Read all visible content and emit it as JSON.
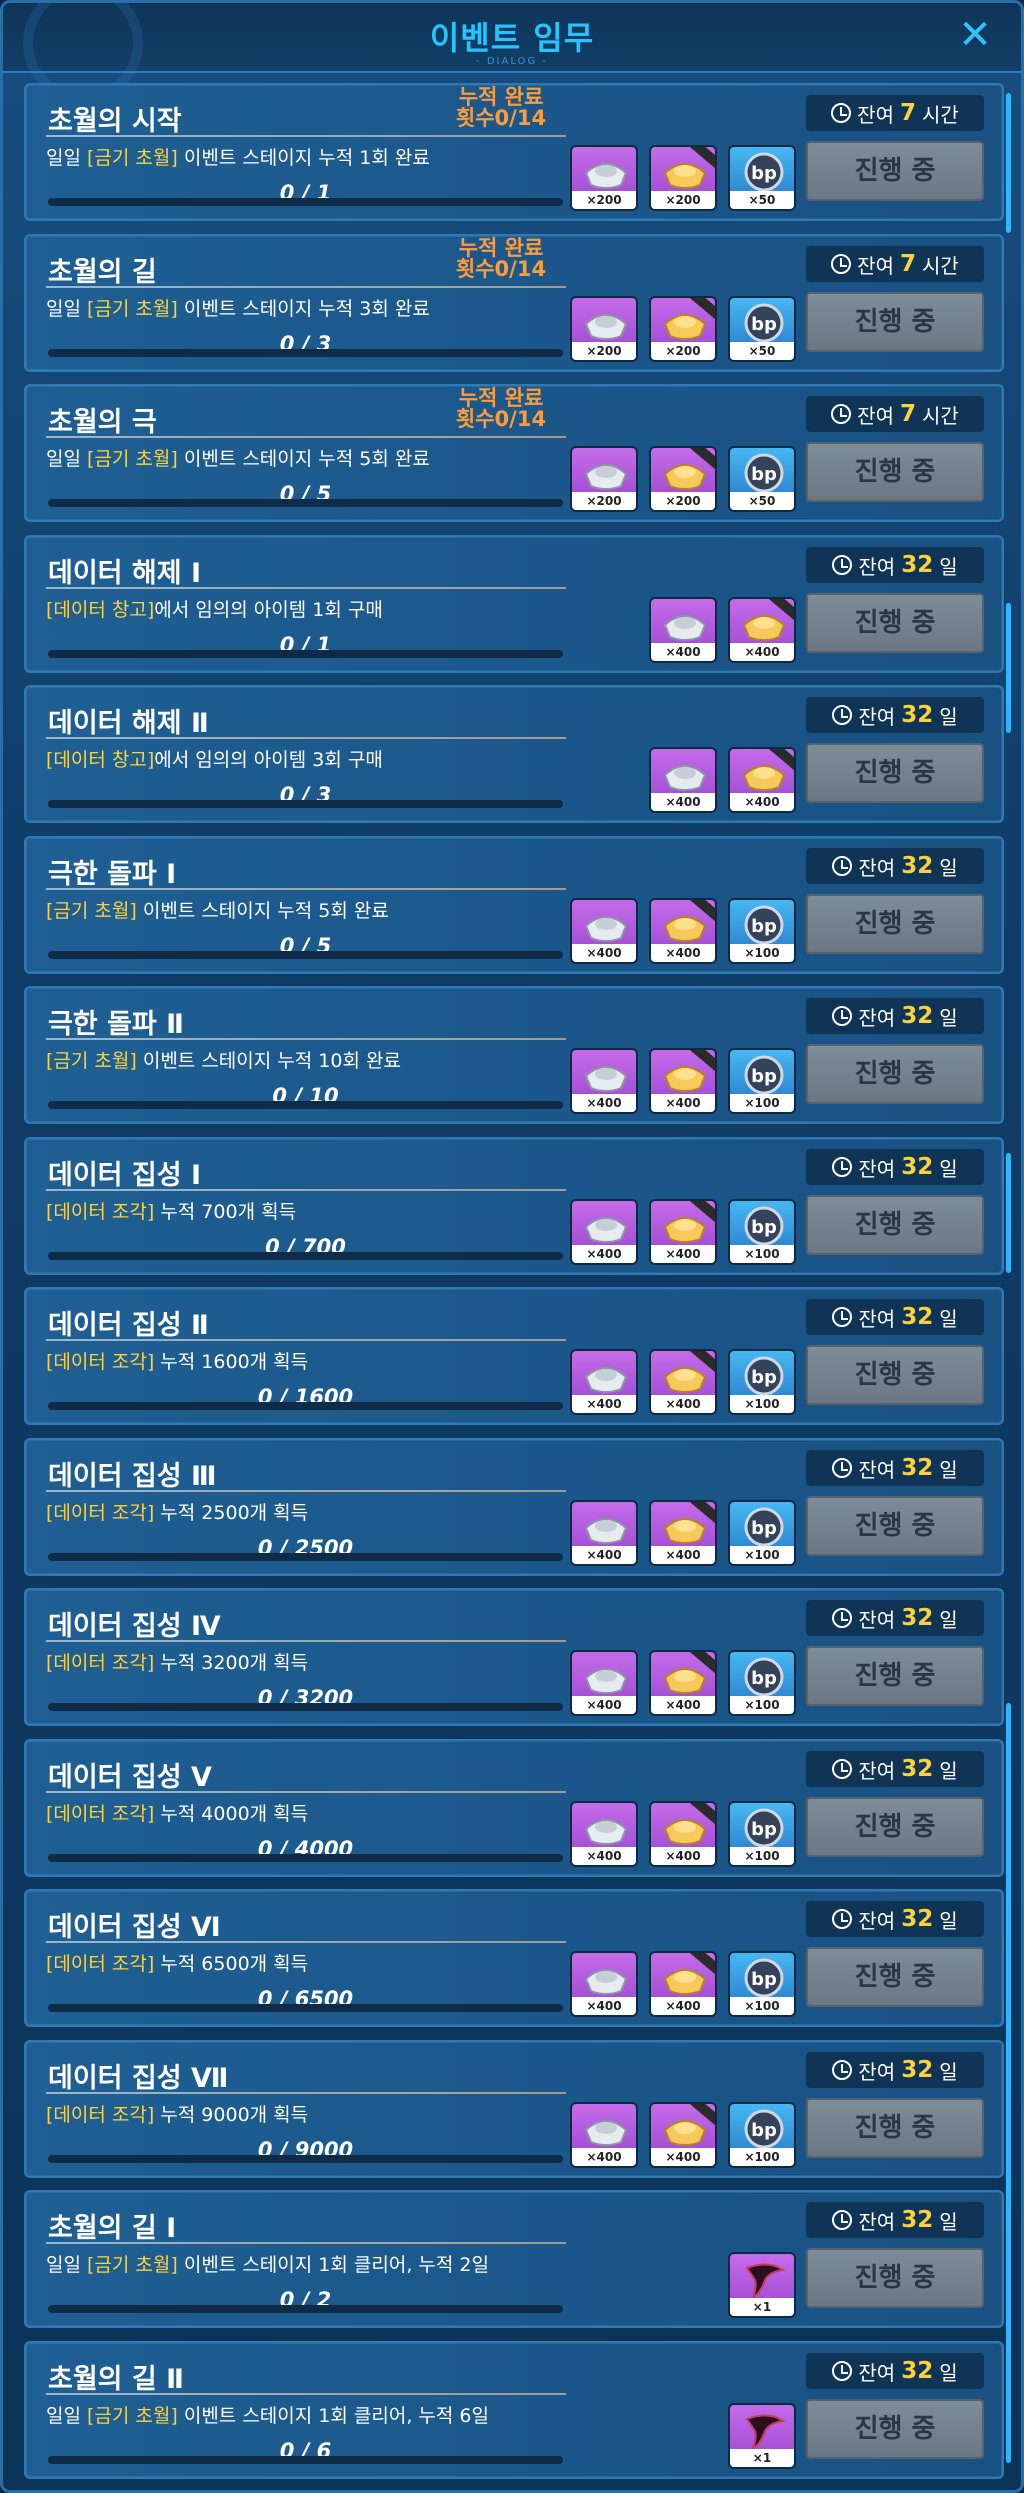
{
  "dialog": {
    "title": "이벤트 임무",
    "subtitle": "- DIALOG -"
  },
  "colors": {
    "accent": "#27c3ff",
    "highlight": "#ffd23c",
    "cumulative": "#ff9c3a",
    "status_bg": "#74828e"
  },
  "tasks": [
    {
      "title": "초월의 시작",
      "cum": "누적 완료\n횟수0/14",
      "desc_pre": "일일 ",
      "desc_hl": "[금기 초월]",
      "desc_post": " 이벤트 스테이지 누적 1회 완료",
      "progress": "0 / 1",
      "progress_value": 0,
      "time_label": "잔여",
      "time_num": "7",
      "time_unit": "시간",
      "status": "진행 중",
      "rewards": [
        {
          "kind": "purple",
          "icon": "silver-ingot-icon",
          "qty": "×200"
        },
        {
          "kind": "purple",
          "icon": "gold-ingot-icon",
          "qty": "×200"
        },
        {
          "kind": "blue",
          "icon": "bp-coin-icon",
          "qty": "×50"
        }
      ]
    },
    {
      "title": "초월의 길",
      "cum": "누적 완료\n횟수0/14",
      "desc_pre": "일일 ",
      "desc_hl": "[금기 초월]",
      "desc_post": " 이벤트 스테이지 누적 3회 완료",
      "progress": "0 / 3",
      "progress_value": 0,
      "time_label": "잔여",
      "time_num": "7",
      "time_unit": "시간",
      "status": "진행 중",
      "rewards": [
        {
          "kind": "purple",
          "icon": "silver-ingot-icon",
          "qty": "×200"
        },
        {
          "kind": "purple",
          "icon": "gold-ingot-icon",
          "qty": "×200"
        },
        {
          "kind": "blue",
          "icon": "bp-coin-icon",
          "qty": "×50"
        }
      ]
    },
    {
      "title": "초월의 극",
      "cum": "누적 완료\n횟수0/14",
      "desc_pre": "일일 ",
      "desc_hl": "[금기 초월]",
      "desc_post": " 이벤트 스테이지 누적 5회 완료",
      "progress": "0 / 5",
      "progress_value": 0,
      "time_label": "잔여",
      "time_num": "7",
      "time_unit": "시간",
      "status": "진행 중",
      "rewards": [
        {
          "kind": "purple",
          "icon": "silver-ingot-icon",
          "qty": "×200"
        },
        {
          "kind": "purple",
          "icon": "gold-ingot-icon",
          "qty": "×200"
        },
        {
          "kind": "blue",
          "icon": "bp-coin-icon",
          "qty": "×50"
        }
      ]
    },
    {
      "title": "데이터 해제 Ⅰ",
      "cum": "",
      "desc_pre": "",
      "desc_hl": "[데이터 창고]",
      "desc_post": "에서 임의의 아이템 1회 구매",
      "progress": "0 / 1",
      "progress_value": 0,
      "time_label": "잔여",
      "time_num": "32",
      "time_unit": "일",
      "status": "진행 중",
      "rewards": [
        {
          "kind": "purple",
          "icon": "silver-ingot-icon",
          "qty": "×400"
        },
        {
          "kind": "purple",
          "icon": "gold-ingot-icon",
          "qty": "×400"
        }
      ]
    },
    {
      "title": "데이터 해제 Ⅱ",
      "cum": "",
      "desc_pre": "",
      "desc_hl": "[데이터 창고]",
      "desc_post": "에서 임의의 아이템 3회 구매",
      "progress": "0 / 3",
      "progress_value": 0,
      "time_label": "잔여",
      "time_num": "32",
      "time_unit": "일",
      "status": "진행 중",
      "rewards": [
        {
          "kind": "purple",
          "icon": "silver-ingot-icon",
          "qty": "×400"
        },
        {
          "kind": "purple",
          "icon": "gold-ingot-icon",
          "qty": "×400"
        }
      ]
    },
    {
      "title": "극한 돌파 Ⅰ",
      "cum": "",
      "desc_pre": "",
      "desc_hl": "[금기 초월]",
      "desc_post": " 이벤트 스테이지 누적 5회 완료",
      "progress": "0 / 5",
      "progress_value": 0,
      "time_label": "잔여",
      "time_num": "32",
      "time_unit": "일",
      "status": "진행 중",
      "rewards": [
        {
          "kind": "purple",
          "icon": "silver-ingot-icon",
          "qty": "×400"
        },
        {
          "kind": "purple",
          "icon": "gold-ingot-icon",
          "qty": "×400"
        },
        {
          "kind": "blue",
          "icon": "bp-coin-icon",
          "qty": "×100"
        }
      ]
    },
    {
      "title": "극한 돌파 Ⅱ",
      "cum": "",
      "desc_pre": "",
      "desc_hl": "[금기 초월]",
      "desc_post": " 이벤트 스테이지 누적 10회 완료",
      "progress": "0 / 10",
      "progress_value": 0,
      "time_label": "잔여",
      "time_num": "32",
      "time_unit": "일",
      "status": "진행 중",
      "rewards": [
        {
          "kind": "purple",
          "icon": "silver-ingot-icon",
          "qty": "×400"
        },
        {
          "kind": "purple",
          "icon": "gold-ingot-icon",
          "qty": "×400"
        },
        {
          "kind": "blue",
          "icon": "bp-coin-icon",
          "qty": "×100"
        }
      ]
    },
    {
      "title": "데이터 집성 Ⅰ",
      "cum": "",
      "desc_pre": "",
      "desc_hl": "[데이터 조각]",
      "desc_post": " 누적 700개 획득",
      "progress": "0 / 700",
      "progress_value": 0,
      "time_label": "잔여",
      "time_num": "32",
      "time_unit": "일",
      "status": "진행 중",
      "rewards": [
        {
          "kind": "purple",
          "icon": "silver-ingot-icon",
          "qty": "×400"
        },
        {
          "kind": "purple",
          "icon": "gold-ingot-icon",
          "qty": "×400"
        },
        {
          "kind": "blue",
          "icon": "bp-coin-icon",
          "qty": "×100"
        }
      ]
    },
    {
      "title": "데이터 집성 Ⅱ",
      "cum": "",
      "desc_pre": "",
      "desc_hl": "[데이터 조각]",
      "desc_post": " 누적 1600개 획득",
      "progress": "0 / 1600",
      "progress_value": 0,
      "time_label": "잔여",
      "time_num": "32",
      "time_unit": "일",
      "status": "진행 중",
      "rewards": [
        {
          "kind": "purple",
          "icon": "silver-ingot-icon",
          "qty": "×400"
        },
        {
          "kind": "purple",
          "icon": "gold-ingot-icon",
          "qty": "×400"
        },
        {
          "kind": "blue",
          "icon": "bp-coin-icon",
          "qty": "×100"
        }
      ]
    },
    {
      "title": "데이터 집성 Ⅲ",
      "cum": "",
      "desc_pre": "",
      "desc_hl": "[데이터 조각]",
      "desc_post": " 누적 2500개 획득",
      "progress": "0 / 2500",
      "progress_value": 0,
      "time_label": "잔여",
      "time_num": "32",
      "time_unit": "일",
      "status": "진행 중",
      "rewards": [
        {
          "kind": "purple",
          "icon": "silver-ingot-icon",
          "qty": "×400"
        },
        {
          "kind": "purple",
          "icon": "gold-ingot-icon",
          "qty": "×400"
        },
        {
          "kind": "blue",
          "icon": "bp-coin-icon",
          "qty": "×100"
        }
      ]
    },
    {
      "title": "데이터 집성 Ⅳ",
      "cum": "",
      "desc_pre": "",
      "desc_hl": "[데이터 조각]",
      "desc_post": " 누적 3200개 획득",
      "progress": "0 / 3200",
      "progress_value": 0,
      "time_label": "잔여",
      "time_num": "32",
      "time_unit": "일",
      "status": "진행 중",
      "rewards": [
        {
          "kind": "purple",
          "icon": "silver-ingot-icon",
          "qty": "×400"
        },
        {
          "kind": "purple",
          "icon": "gold-ingot-icon",
          "qty": "×400"
        },
        {
          "kind": "blue",
          "icon": "bp-coin-icon",
          "qty": "×100"
        }
      ]
    },
    {
      "title": "데이터 집성 Ⅴ",
      "cum": "",
      "desc_pre": "",
      "desc_hl": "[데이터 조각]",
      "desc_post": " 누적 4000개 획득",
      "progress": "0 / 4000",
      "progress_value": 0,
      "time_label": "잔여",
      "time_num": "32",
      "time_unit": "일",
      "status": "진행 중",
      "rewards": [
        {
          "kind": "purple",
          "icon": "silver-ingot-icon",
          "qty": "×400"
        },
        {
          "kind": "purple",
          "icon": "gold-ingot-icon",
          "qty": "×400"
        },
        {
          "kind": "blue",
          "icon": "bp-coin-icon",
          "qty": "×100"
        }
      ]
    },
    {
      "title": "데이터 집성 Ⅵ",
      "cum": "",
      "desc_pre": "",
      "desc_hl": "[데이터 조각]",
      "desc_post": " 누적 6500개 획득",
      "progress": "0 / 6500",
      "progress_value": 0,
      "time_label": "잔여",
      "time_num": "32",
      "time_unit": "일",
      "status": "진행 중",
      "rewards": [
        {
          "kind": "purple",
          "icon": "silver-ingot-icon",
          "qty": "×400"
        },
        {
          "kind": "purple",
          "icon": "gold-ingot-icon",
          "qty": "×400"
        },
        {
          "kind": "blue",
          "icon": "bp-coin-icon",
          "qty": "×100"
        }
      ]
    },
    {
      "title": "데이터 집성 Ⅶ",
      "cum": "",
      "desc_pre": "",
      "desc_hl": "[데이터 조각]",
      "desc_post": " 누적 9000개 획득",
      "progress": "0 / 9000",
      "progress_value": 0,
      "time_label": "잔여",
      "time_num": "32",
      "time_unit": "일",
      "status": "진행 중",
      "rewards": [
        {
          "kind": "purple",
          "icon": "silver-ingot-icon",
          "qty": "×400"
        },
        {
          "kind": "purple",
          "icon": "gold-ingot-icon",
          "qty": "×400"
        },
        {
          "kind": "blue",
          "icon": "bp-coin-icon",
          "qty": "×100"
        }
      ]
    },
    {
      "title": "초월의 길 Ⅰ",
      "cum": "",
      "desc_pre": "일일 ",
      "desc_hl": "[금기 초월]",
      "desc_post": " 이벤트 스테이지 1회 클리어, 누적 2일",
      "progress": "0 / 2",
      "progress_value": 0,
      "time_label": "잔여",
      "time_num": "32",
      "time_unit": "일",
      "status": "진행 중",
      "rewards": [
        {
          "kind": "purple",
          "icon": "dark-feather-icon",
          "qty": "×1"
        }
      ]
    },
    {
      "title": "초월의 길 Ⅱ",
      "cum": "",
      "desc_pre": "일일 ",
      "desc_hl": "[금기 초월]",
      "desc_post": " 이벤트 스테이지 1회 클리어, 누적 6일",
      "progress": "0 / 6",
      "progress_value": 0,
      "time_label": "잔여",
      "time_num": "32",
      "time_unit": "일",
      "status": "진행 중",
      "rewards": [
        {
          "kind": "purple",
          "icon": "dark-feather-icon",
          "qty": "×1"
        }
      ]
    }
  ]
}
